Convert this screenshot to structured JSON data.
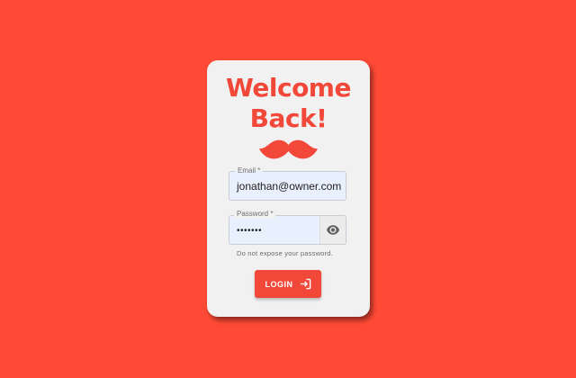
{
  "card": {
    "title_line1": "Welcome",
    "title_line2": "Back!",
    "logo_icon": "mustache-icon"
  },
  "email_field": {
    "label": "Email *",
    "value": "jonathan@owner.com"
  },
  "password_field": {
    "label": "Password *",
    "value": "•••••••",
    "toggle_icon": "eye-icon",
    "helper_text": "Do not expose your password."
  },
  "login_button": {
    "label": "LOGIN",
    "icon": "login-icon"
  },
  "colors": {
    "background": "#ff4a36",
    "accent": "#f2483a",
    "card": "#f1f1f1",
    "input_fill": "#e9f0fd"
  }
}
